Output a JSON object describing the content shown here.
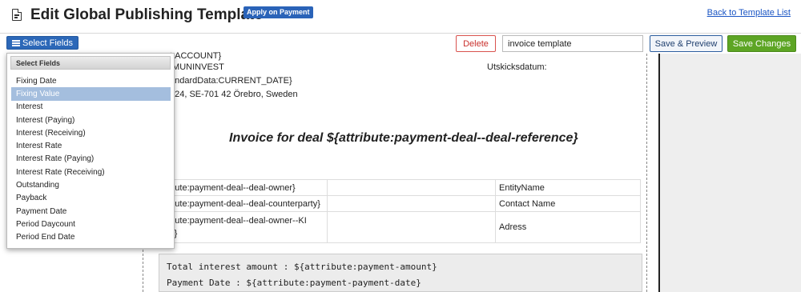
{
  "header": {
    "title": "Edit Global Publishing Template",
    "badge": "Apply on Payment",
    "back_link": "Back to Template List"
  },
  "toolbar": {
    "select_fields_label": "Select Fields",
    "delete_label": "Delete",
    "template_name_value": "invoice template",
    "save_preview_label": "Save & Preview",
    "save_changes_label": "Save Changes"
  },
  "dropdown": {
    "header": "Select Fields",
    "selected": "Fixing Value",
    "items": [
      "Fixing Date",
      "Fixing Value",
      "Interest",
      "Interest (Paying)",
      "Interest (Receiving)",
      "Interest Rate",
      "Interest Rate (Paying)",
      "Interest Rate (Receiving)",
      "Outstanding",
      "Payback",
      "Payment Date",
      "Period Daycount",
      "Period End Date"
    ]
  },
  "document": {
    "line1": "t:ACCOUNT}",
    "line2": "IMUNINVEST",
    "line3": "andardData:CURRENT_DATE}",
    "line4": "124, SE-701 42 Örebro, Sweden",
    "send_date_label": "Utskicksdatum:",
    "invoice_title": "Invoice for deal ${attribute:payment-deal--deal-reference}",
    "table_rows": [
      [
        "tribute:payment-deal--deal-owner}",
        "",
        "EntityName"
      ],
      [
        "tribute:payment-deal--deal-counterparty}",
        "",
        "Contact Name"
      ],
      [
        "tribute:payment-deal--deal-owner--KI\ning}",
        "",
        "Adress"
      ]
    ],
    "total_line": "Total interest amount : ${attribute:payment-amount}",
    "payment_date_line": "Payment Date : ${attribute:payment-payment-date}"
  },
  "colors": {
    "badge": "#2a63b8",
    "select_button": "#2c68b8",
    "save_changes": "#5da524",
    "delete_border": "#d9534f",
    "selected_item": "#a4bede"
  }
}
